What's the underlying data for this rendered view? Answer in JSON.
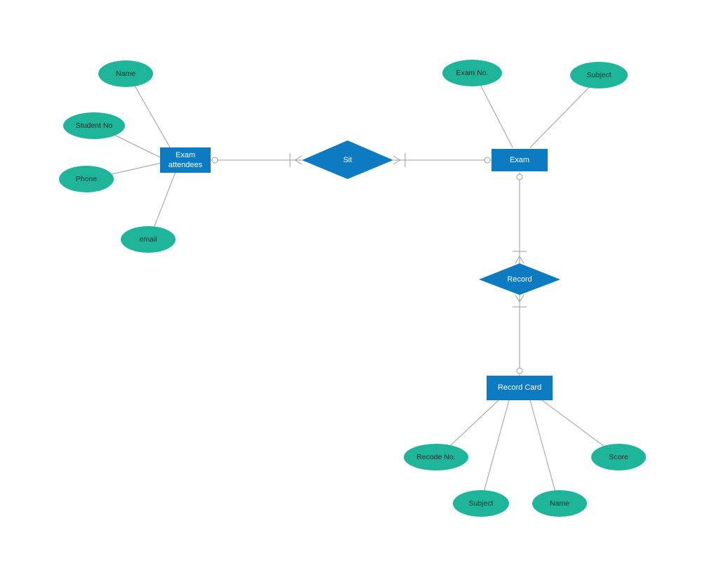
{
  "entities": {
    "exam_attendees": "Exam attendees",
    "exam": "Exam",
    "record_card": "Record Card"
  },
  "relationships": {
    "sit": "Sit",
    "record": "Record"
  },
  "attributes": {
    "name": "Name",
    "student_no": "Student No",
    "phone": "Phone",
    "email": "email",
    "exam_no": "Exam No.",
    "subject": "Subject",
    "recode_no": "Recode No.",
    "rc_subject": "Subject",
    "rc_name": "Name",
    "score": "Score"
  },
  "colors": {
    "entity": "#0d7bc1",
    "relationship": "#0d7bc1",
    "attribute": "#1fb59b",
    "line": "#9d9d9d"
  }
}
